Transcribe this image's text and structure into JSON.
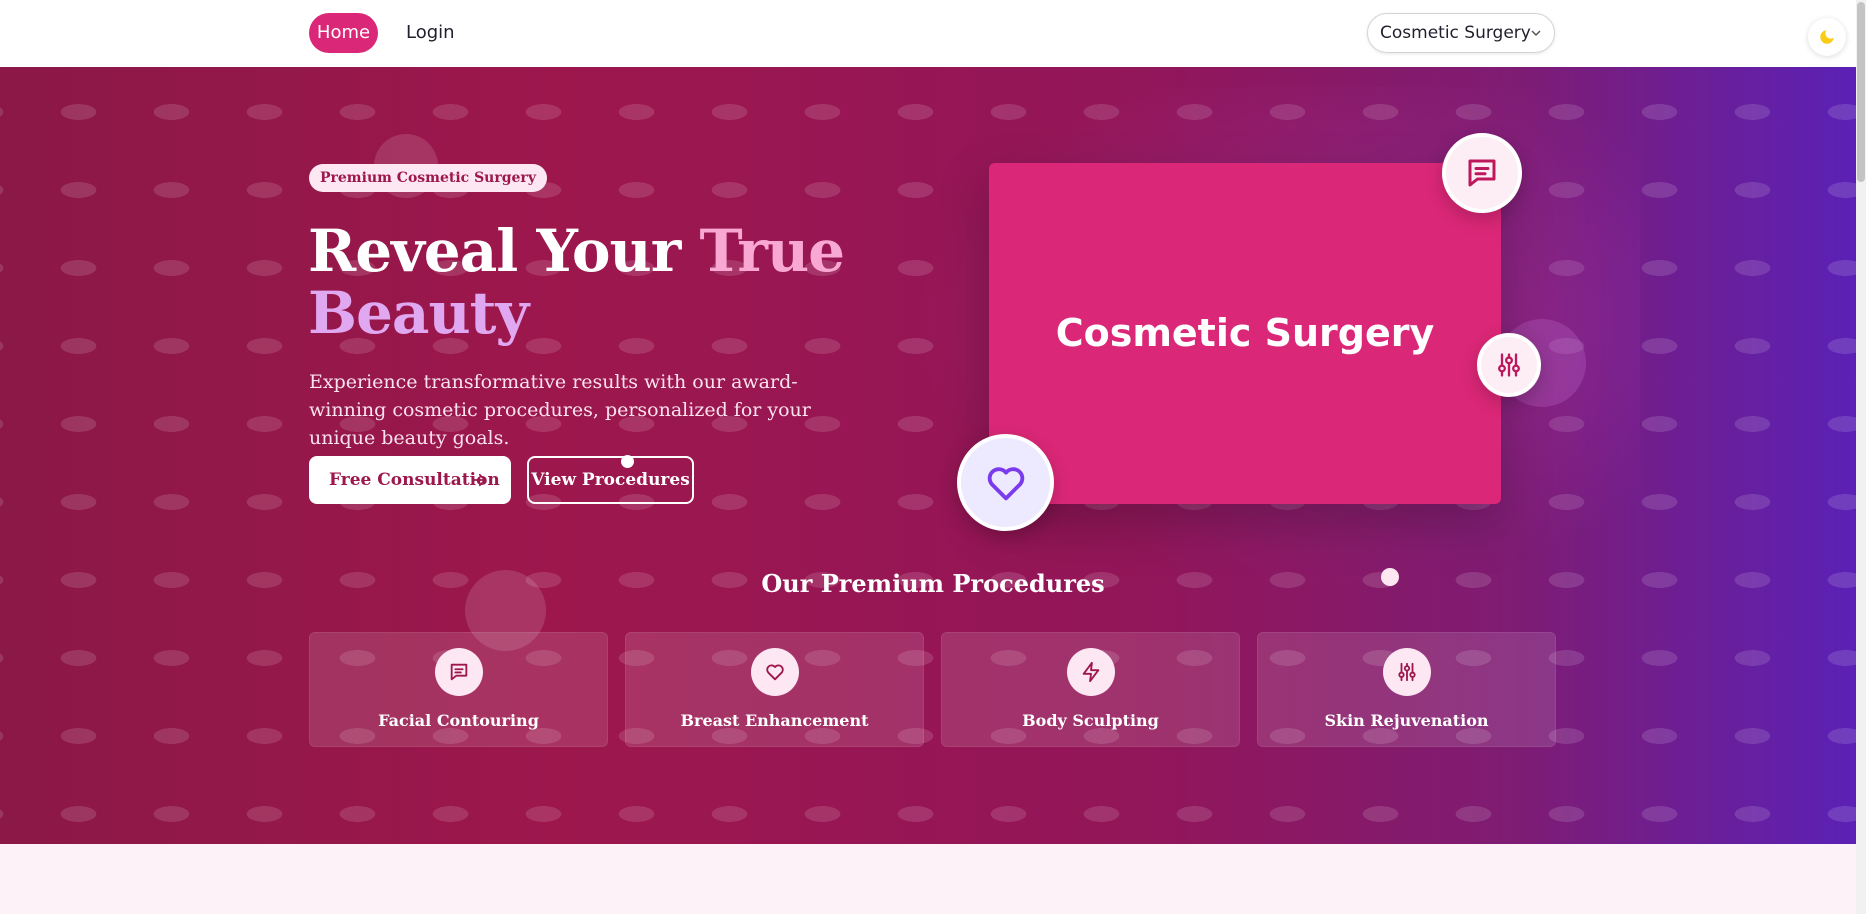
{
  "nav": {
    "home_label": "Home",
    "login_label": "Login",
    "select_value": "Cosmetic Surgery"
  },
  "hero": {
    "badge": "Premium Cosmetic Surgery",
    "title_part1": "Reveal Your ",
    "title_accent1": "True",
    "title_accent2": "Beauty",
    "subtitle": "Experience transformative results with our award-winning cosmetic procedures, personalized for your unique beauty goals.",
    "primary_cta": "Free Consultation",
    "secondary_cta": "View Procedures",
    "image_label": "Cosmetic Surgery"
  },
  "procedures": {
    "title": "Our Premium Procedures",
    "items": [
      {
        "label": "Facial Contouring",
        "icon": "message-square-icon"
      },
      {
        "label": "Breast Enhancement",
        "icon": "heart-icon"
      },
      {
        "label": "Body Sculpting",
        "icon": "zap-icon"
      },
      {
        "label": "Skin Rejuvenation",
        "icon": "sliders-icon"
      }
    ]
  },
  "colors": {
    "brand_pink": "#db2777",
    "deep_pink": "#9d174d",
    "violet": "#5b21b6",
    "light_pink": "#fce7f3"
  }
}
